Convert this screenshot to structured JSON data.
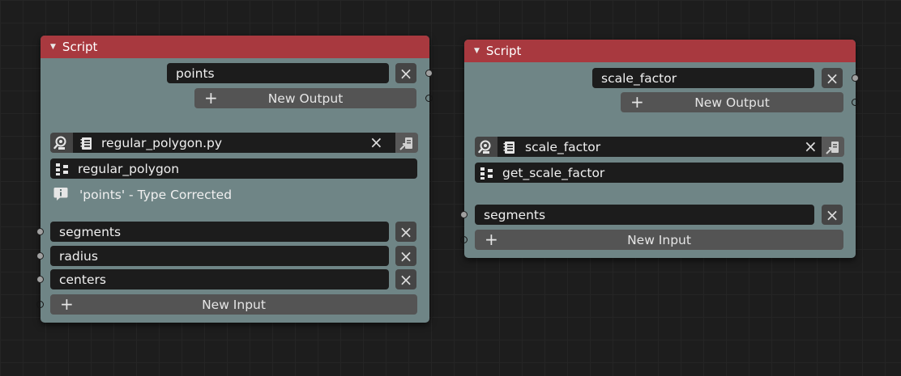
{
  "nodes": [
    {
      "title": "Script",
      "outputs": [
        "points"
      ],
      "new_output_label": "New Output",
      "script_file": "regular_polygon.py",
      "script_function": "regular_polygon",
      "info_message": "'points' - Type Corrected",
      "inputs": [
        "segments",
        "radius",
        "centers"
      ],
      "new_input_label": "New Input"
    },
    {
      "title": "Script",
      "outputs": [
        "scale_factor"
      ],
      "new_output_label": "New Output",
      "script_file": "scale_factor",
      "script_function": "get_scale_factor",
      "inputs": [
        "segments"
      ],
      "new_input_label": "New Input"
    }
  ],
  "icons": {
    "collapse": "triangle-down",
    "remove": "x",
    "add": "plus",
    "browse_script": "search-gear",
    "text_document": "notepad",
    "function": "node-tree",
    "info": "info-speech",
    "open_file": "file-arrow"
  },
  "colors": {
    "header": "#a8393f",
    "node_body": "#6f8586",
    "field": "#1c1c1c"
  }
}
